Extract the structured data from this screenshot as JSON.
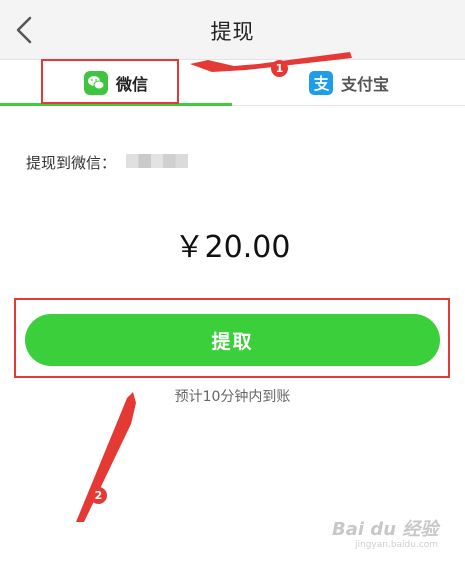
{
  "header": {
    "title": "提现"
  },
  "tabs": [
    {
      "label": "微信",
      "selected": true
    },
    {
      "label": "支付宝",
      "selected": false
    }
  ],
  "withdraw_to_label": "提现到微信：",
  "amount": "￥20.00",
  "withdraw_button_label": "提取",
  "eta_text": "预计10分钟内到账",
  "annotations": [
    {
      "number": "1"
    },
    {
      "number": "2"
    }
  ],
  "watermark": {
    "brand": "Bai du 经验",
    "url": "jingyan.baidu.com"
  },
  "colors": {
    "accent_green": "#3ccf3c",
    "annotation_red": "#e53935",
    "alipay_blue": "#1e9ee7"
  }
}
